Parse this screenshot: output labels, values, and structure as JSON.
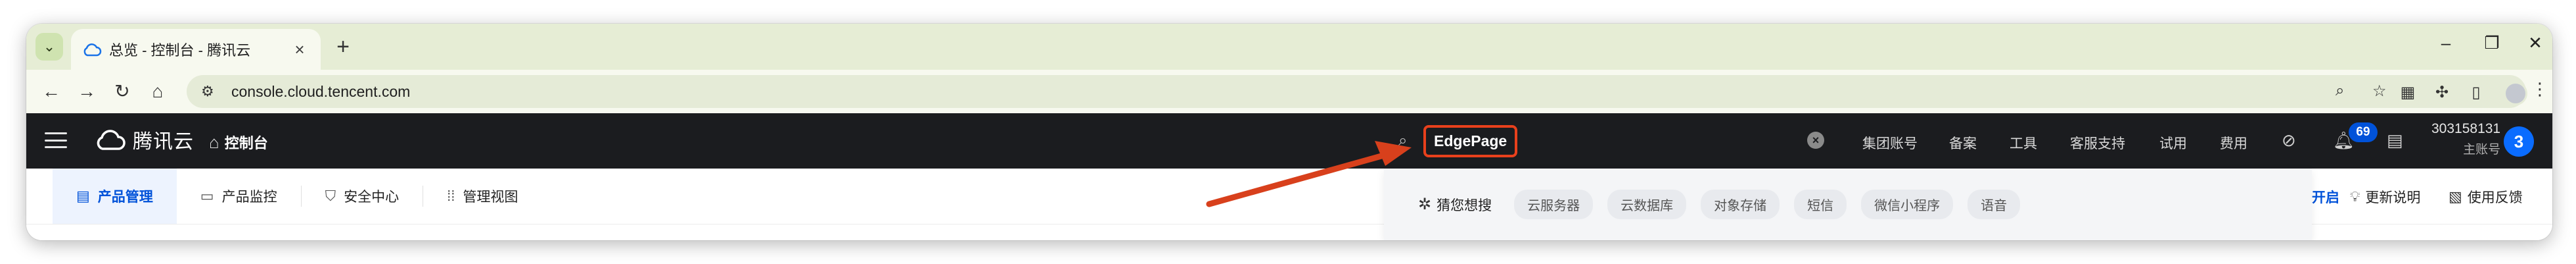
{
  "browser": {
    "tab_title": "总览 - 控制台 - 腾讯云",
    "url": "console.cloud.tencent.com"
  },
  "console": {
    "brand": "腾讯云",
    "home_label": "控制台",
    "search_query": "EdgePage",
    "top_nav": [
      "集团账号",
      "备案",
      "工具",
      "客服支持",
      "试用",
      "费用"
    ],
    "notification_count": "69",
    "account_id": "303158131",
    "account_role": "主账号",
    "avatar_letter": "3",
    "sub_tabs": [
      "产品管理",
      "产品监控",
      "安全中心",
      "管理视图"
    ],
    "suggest_label": "猜您想搜",
    "suggest_chips": [
      "云服务器",
      "云数据库",
      "对象存储",
      "短信",
      "微信小程序",
      "语音"
    ],
    "partial_link": "开启",
    "links": [
      "更新说明",
      "使用反馈"
    ]
  },
  "colors": {
    "accent": "#0052d9",
    "highlight": "#e8401c",
    "topbar": "#1b1c1f"
  }
}
